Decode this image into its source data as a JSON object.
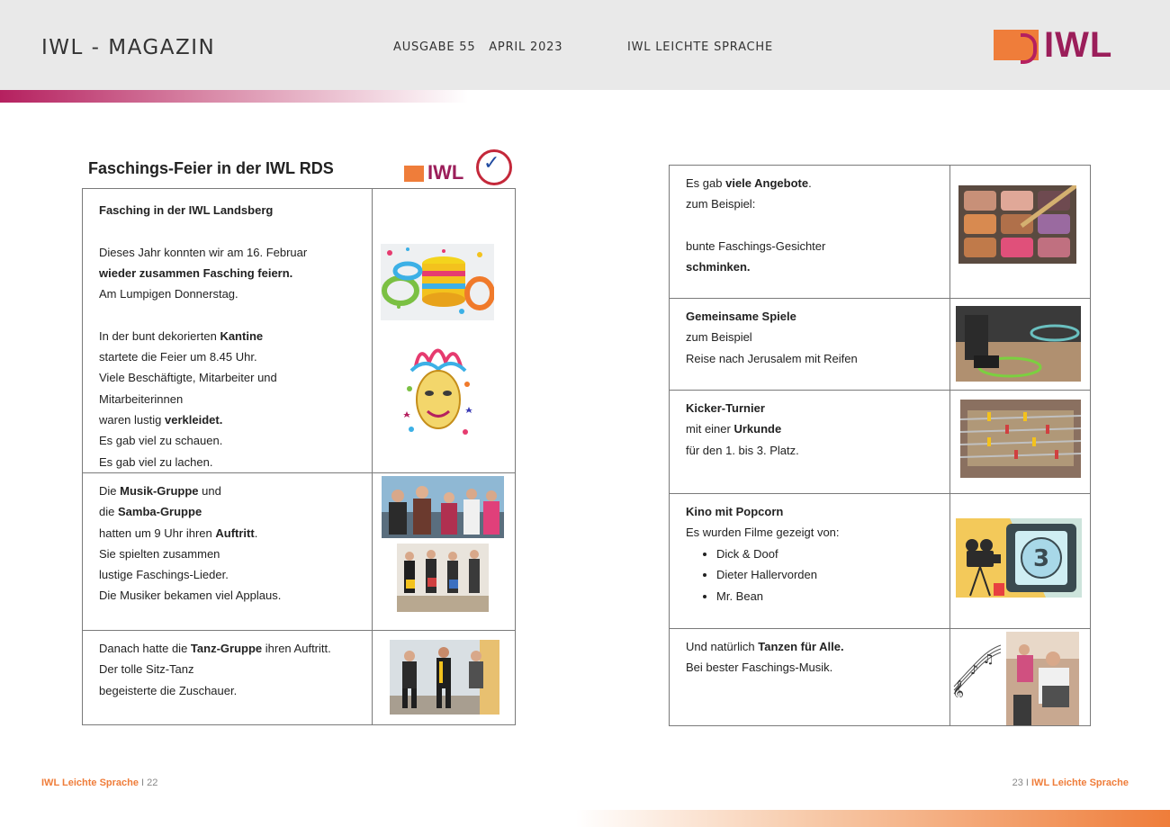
{
  "header": {
    "magazine_title": "IWL - MAGAZIN",
    "issue": "AUSGABE 55   APRIL 2023",
    "series": "IWL LEICHTE SPRACHE",
    "logo_text": "IWL"
  },
  "left_page": {
    "title": "Faschings-Feier in der IWL RDS",
    "badge_text": "IWL",
    "rows": [
      {
        "heading": "Fasching in der IWL Landsberg",
        "lines": [
          "Dieses Jahr konnten wir am 16. Februar",
          "wieder zusammen Fasching feiern.",
          "Am Lumpigen Donnerstag.",
          "In der bunt dekorierten",
          "Kantine",
          "startete die Feier um 8.45 Uhr.",
          "Viele Beschäftigte, Mitarbeiter und",
          "Mitarbeiterinnen",
          "waren lustig",
          "verkleidet.",
          "Es gab viel zu schauen.",
          "Es gab viel zu lachen."
        ]
      },
      {
        "lines": [
          "Die",
          "Musik-Gruppe",
          "und",
          "die",
          "Samba-Gruppe",
          "hatten um 9 Uhr ihren",
          "Auftritt",
          ".",
          "Sie spielten zusammen",
          "lustige Faschings-Lieder.",
          "Die Musiker bekamen viel Applaus."
        ]
      },
      {
        "lines": [
          "Danach hatte die",
          "Tanz-Gruppe",
          "ihren Auftritt.",
          "Der tolle Sitz-Tanz",
          "begeisterte die Zuschauer."
        ]
      }
    ]
  },
  "right_page": {
    "rows": [
      {
        "lines": [
          "Es gab",
          "viele Angebote",
          ".",
          "zum Beispiel:",
          "bunte Faschings-Gesichter",
          "schminken."
        ]
      },
      {
        "heading": "Gemeinsame Spiele",
        "lines": [
          "zum Beispiel",
          "Reise nach Jerusalem mit Reifen"
        ]
      },
      {
        "heading": "Kicker-Turnier",
        "lines": [
          "mit einer",
          "Urkunde",
          "für den 1. bis 3. Platz."
        ]
      },
      {
        "heading": "Kino mit Popcorn",
        "lines": [
          "Es wurden Filme gezeigt von:"
        ],
        "films": [
          "Dick & Doof",
          "Dieter Hallervorden",
          "Mr. Bean"
        ],
        "film_number": "3"
      },
      {
        "lines": [
          "Und natürlich",
          "Tanzen für Alle.",
          "Bei bester Faschings-Musik."
        ]
      }
    ]
  },
  "footer": {
    "left_label": "IWL Leichte Sprache",
    "left_page": " I 22",
    "right_page": "23 I ",
    "right_label": "IWL Leichte Sprache"
  },
  "colors": {
    "brand_orange": "#ef7d3a",
    "brand_magenta": "#9b1e5a",
    "header_gray": "#e9e9e9"
  }
}
